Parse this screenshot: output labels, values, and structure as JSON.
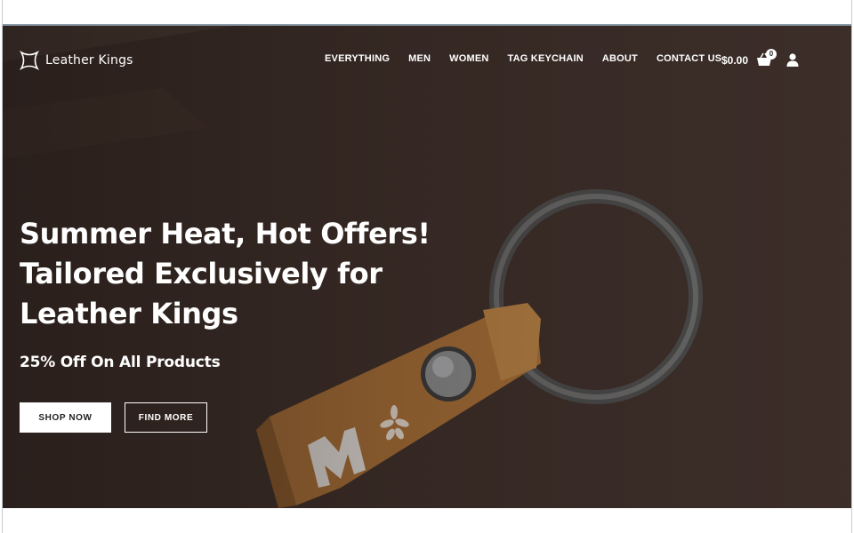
{
  "brand": {
    "name": "Leather Kings",
    "logo_icon": "crown-frame-icon"
  },
  "nav": {
    "items": [
      {
        "label": "EVERYTHING"
      },
      {
        "label": "MEN"
      },
      {
        "label": "WOMEN"
      },
      {
        "label": "TAG KEYCHAIN"
      },
      {
        "label": "ABOUT"
      },
      {
        "label": "CONTACT US"
      }
    ]
  },
  "cart": {
    "total": "$0.00",
    "count": "0",
    "icon": "basket-icon"
  },
  "account": {
    "icon": "user-icon"
  },
  "hero": {
    "headline_line1": "Summer Heat, Hot Offers!",
    "headline_line2": "Tailored Exclusively for",
    "headline_line3": "Leather Kings",
    "subheadline": "25% Off On All Products",
    "primary_button": "SHOP NOW",
    "secondary_button": "FIND MORE"
  },
  "colors": {
    "hero_background": "#3b2c27",
    "text": "#ffffff",
    "keychain_leather": "#b07a3c",
    "ring_metal": "#5a5a5a"
  }
}
